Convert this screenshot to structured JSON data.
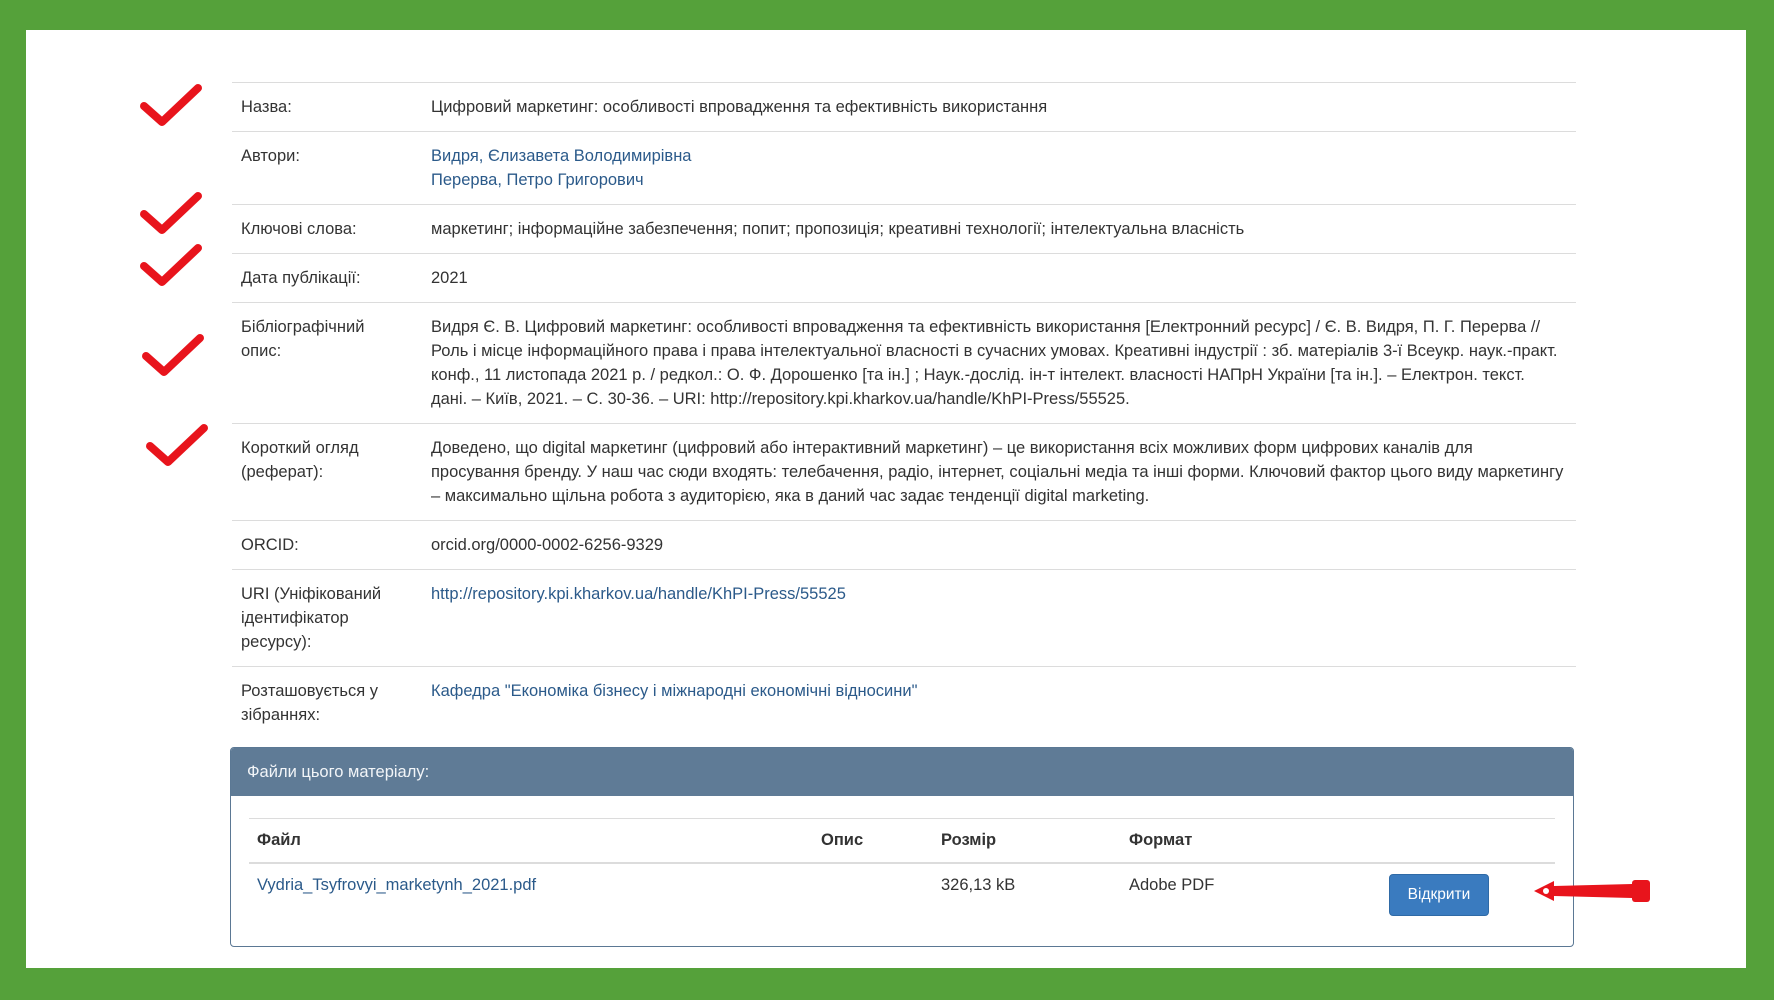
{
  "metadata": {
    "rows": [
      {
        "label": [
          "Назва:"
        ],
        "value": [
          "Цифровий маркетинг: особливості впровадження та ефективність використання"
        ],
        "link": false
      },
      {
        "label": [
          "Автори:"
        ],
        "value": [
          "Видря, Єлизавета Володимирівна",
          "Перерва, Петро Григорович"
        ],
        "link": true
      },
      {
        "label": [
          "Ключові слова:"
        ],
        "value": [
          "маркетинг; інформаційне забезпечення; попит; пропозиція; креативні технології; інтелектуальна власність"
        ],
        "link": false
      },
      {
        "label": [
          "Дата публікації:"
        ],
        "value": [
          "2021"
        ],
        "link": false
      },
      {
        "label": [
          "Бібліографічний",
          "опис:"
        ],
        "value": [
          "Видря Є. В. Цифровий маркетинг: особливості впровадження та ефективність використання [Електронний ресурс] / Є. В. Видря, П. Г. Перерва //",
          "Роль і місце інформаційного права і права інтелектуальної власності в сучасних умовах. Креативні індустрії : зб. матеріалів 3-ї Всеукр. наук.-практ.",
          "конф., 11 листопада 2021 р. / редкол.: О. Ф. Дорошенко [та ін.] ; Наук.-дослід. ін-т інтелект. власності НАПрН України [та ін.]. – Електрон. текст.",
          "дані. – Київ, 2021. – С. 30-36. – URI: http://repository.kpi.kharkov.ua/handle/KhPI-Press/55525."
        ],
        "link": false
      },
      {
        "label": [
          "Короткий огляд",
          "(реферат):"
        ],
        "value": [
          "Доведено, що digital маркетинг (цифровий або інтерактивний маркетинг) – це використання всіх можливих форм цифрових каналів для",
          "просування бренду. У наш час сюди входять: телебачення, радіо, інтернет, соціальні медіа та інші форми. Ключовий фактор цього виду маркетингу",
          "– максимально щільна робота з аудиторією, яка в даний час задає тенденції digital marketing."
        ],
        "link": false
      },
      {
        "label": [
          "ORCID:"
        ],
        "value": [
          "orcid.org/0000-0002-6256-9329"
        ],
        "link": false
      },
      {
        "label": [
          "URI (Уніфікований",
          "ідентифікатор",
          "ресурсу):"
        ],
        "value": [
          "http://repository.kpi.kharkov.ua/handle/KhPI-Press/55525"
        ],
        "link": true
      },
      {
        "label": [
          "Розташовується у",
          "зібраннях:"
        ],
        "value": [
          "Кафедра \"Економіка бізнесу і міжнародні економічні відносини\""
        ],
        "link": true
      }
    ]
  },
  "files": {
    "heading": "Файли цього матеріалу:",
    "columns": [
      "Файл",
      "Опис",
      "Розмір",
      "Формат",
      ""
    ],
    "rows": [
      {
        "file": "Vydria_Tsyfrovyi_marketynh_2021.pdf",
        "description": "",
        "size": "326,13 kB",
        "format": "Adobe PDF",
        "button": "Відкрити"
      }
    ]
  },
  "annotations": {
    "check_icon": "red-checkmark-icon",
    "check_color": "#e8141c",
    "arrow_icon": "red-pointer-arrow-icon",
    "arrow_color": "#e8141c",
    "frame_color": "#55a13a"
  }
}
